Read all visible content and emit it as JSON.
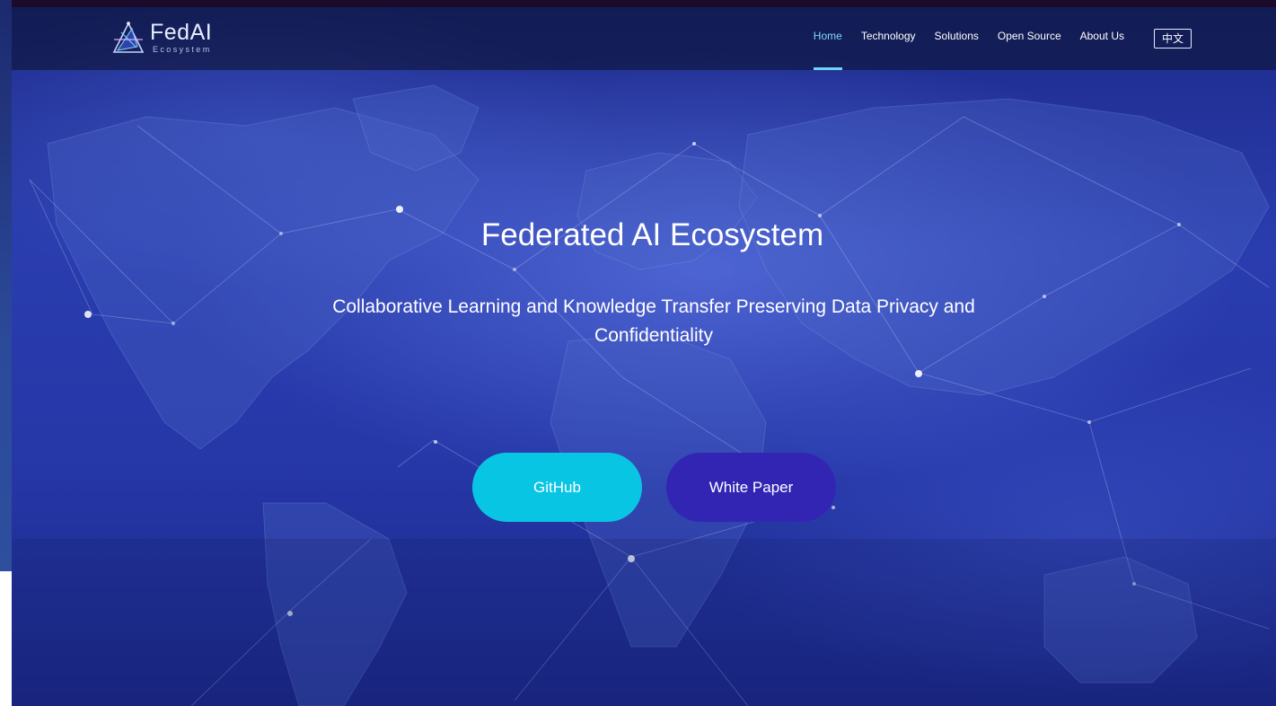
{
  "brand": {
    "name": "FedAI",
    "tagline": "Ecosystem"
  },
  "nav": {
    "items": [
      {
        "label": "Home",
        "active": true
      },
      {
        "label": "Technology",
        "active": false
      },
      {
        "label": "Solutions",
        "active": false
      },
      {
        "label": "Open Source",
        "active": false
      },
      {
        "label": "About Us",
        "active": false
      }
    ],
    "language_toggle": "中文"
  },
  "hero": {
    "title": "Federated AI Ecosystem",
    "subtitle": "Collaborative Learning and Knowledge Transfer Preserving Data Privacy and Confidentiality",
    "buttons": {
      "github": "GitHub",
      "white_paper": "White Paper"
    },
    "background": "world-map-network"
  },
  "colors": {
    "nav_active": "#7fd8ff",
    "github_button": "#09c5e4",
    "white_paper_button": "#3225b4",
    "hero_background": "#2637a8"
  }
}
